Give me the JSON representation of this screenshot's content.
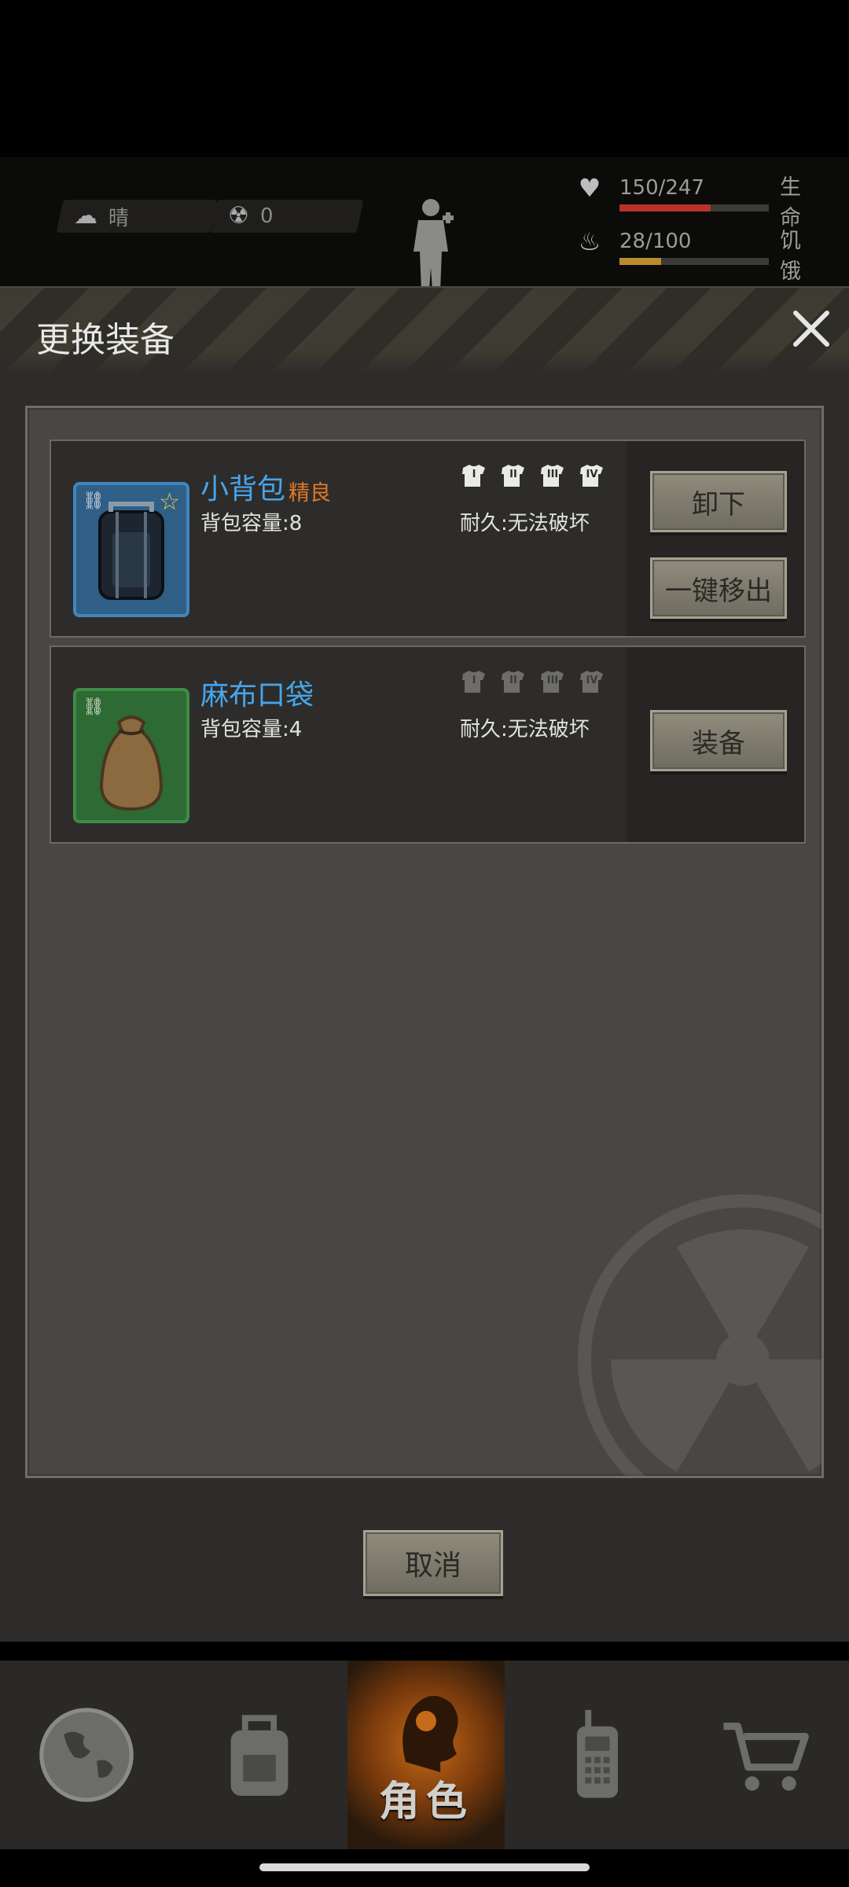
{
  "status": {
    "weather": "晴",
    "radiation": "0",
    "health": {
      "value": "150/247",
      "label": "生命",
      "fraction": 0.61,
      "color": "#b8322a"
    },
    "hunger": {
      "value": "28/100",
      "label": "饥饿",
      "fraction": 0.28,
      "color": "#b98a2e"
    }
  },
  "dialog": {
    "title": "更换装备",
    "items": [
      {
        "name": "小背包",
        "quality": "精良",
        "capacity": "背包容量:8",
        "durability": "耐久:无法破坏",
        "tiers": [
          "I",
          "II",
          "III",
          "IV"
        ],
        "tiers_active": true,
        "icon_bg": "#2f5f86",
        "icon": "backpack-icon",
        "buttons": {
          "unequip": "卸下",
          "remove_all": "一键移出"
        }
      },
      {
        "name": "麻布口袋",
        "capacity": "背包容量:4",
        "durability": "耐久:无法破坏",
        "tiers": [
          "I",
          "II",
          "III",
          "IV"
        ],
        "tiers_active": false,
        "icon_bg": "#2e6a33",
        "icon": "sack-icon",
        "buttons": {
          "equip": "装备"
        }
      }
    ],
    "cancel": "取消"
  },
  "nav": {
    "tabs": [
      "world-icon",
      "backpack-icon",
      "character-icon",
      "radio-icon",
      "cart-icon"
    ],
    "active_label": "角色"
  },
  "colors": {
    "accent_blue": "#47a5ec",
    "accent_orange": "#e0792a",
    "active_tab": "#c46a18"
  }
}
